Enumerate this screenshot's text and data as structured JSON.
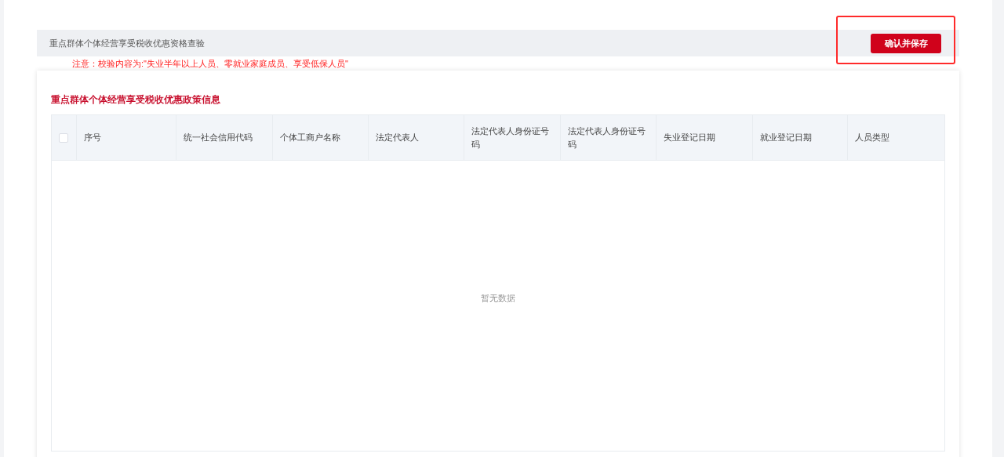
{
  "header": {
    "title": "重点群体个体经营享受税收优惠资格查验",
    "button": "确认并保存",
    "highlighted": true
  },
  "note": "注意：校验内容为:\"失业半年以上人员、零就业家庭成员、享受低保人员\"",
  "card": {
    "title": "重点群体个体经营享受税收优惠政策信息"
  },
  "table": {
    "select_all": {
      "checked": false
    },
    "columns": [
      "序号",
      "统一社会信用代码",
      "个体工商户名称",
      "法定代表人",
      "法定代表人身份证号码",
      "法定代表人身份证号码",
      "失业登记日期",
      "就业登记日期",
      "人员类型"
    ],
    "empty_text": "暂无数据"
  }
}
